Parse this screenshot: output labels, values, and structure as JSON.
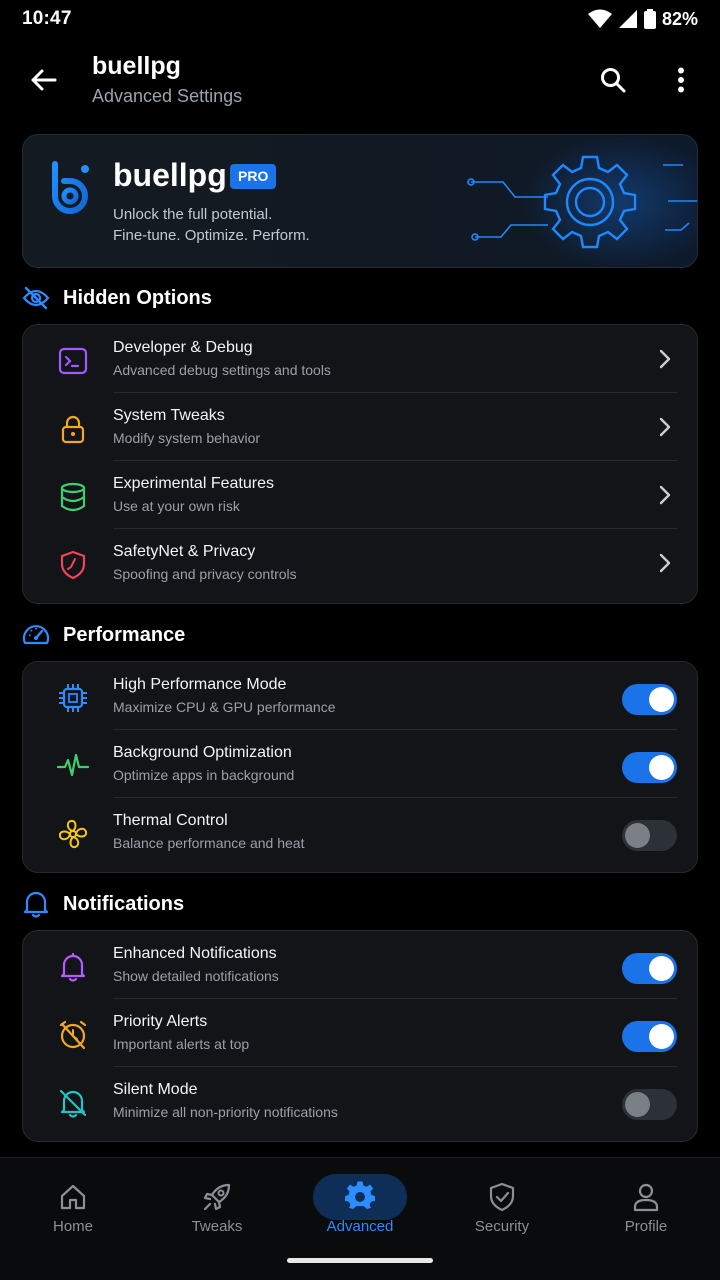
{
  "status": {
    "time": "10:47",
    "battery": "82%"
  },
  "appbar": {
    "title": "buellpg",
    "subtitle": "Advanced Settings"
  },
  "hero": {
    "name": "buellpg",
    "badge": "PRO",
    "line1": "Unlock the full potential.",
    "line2": "Fine-tune. Optimize. Perform."
  },
  "sections": {
    "hidden": {
      "title": "Hidden Options",
      "items": [
        {
          "title": "Developer & Debug",
          "subtitle": "Advanced debug settings and tools",
          "icon": "terminal-icon",
          "color": "#a259ff"
        },
        {
          "title": "System Tweaks",
          "subtitle": "Modify system behavior",
          "icon": "lock-icon",
          "color": "#f5a623"
        },
        {
          "title": "Experimental Features",
          "subtitle": "Use at your own risk",
          "icon": "database-icon",
          "color": "#3ecf6e"
        },
        {
          "title": "SafetyNet & Privacy",
          "subtitle": "Spoofing and privacy controls",
          "icon": "shield-icon",
          "color": "#f0445a"
        }
      ]
    },
    "performance": {
      "title": "Performance",
      "items": [
        {
          "title": "High Performance Mode",
          "subtitle": "Maximize CPU & GPU performance",
          "icon": "cpu-icon",
          "color": "#2d8cff",
          "on": true
        },
        {
          "title": "Background Optimization",
          "subtitle": "Optimize apps in background",
          "icon": "pulse-icon",
          "color": "#3ecf6e",
          "on": true
        },
        {
          "title": "Thermal Control",
          "subtitle": "Balance performance and heat",
          "icon": "fan-icon",
          "color": "#f5c518",
          "on": false
        }
      ]
    },
    "notifications": {
      "title": "Notifications",
      "items": [
        {
          "title": "Enhanced Notifications",
          "subtitle": "Show detailed notifications",
          "icon": "bell-icon",
          "color": "#b35cff",
          "on": true
        },
        {
          "title": "Priority Alerts",
          "subtitle": "Important alerts at top",
          "icon": "alarm-off-icon",
          "color": "#f5a623",
          "on": true
        },
        {
          "title": "Silent Mode",
          "subtitle": "Minimize all non-priority notifications",
          "icon": "bell-off-icon",
          "color": "#22c4c4",
          "on": false
        }
      ]
    }
  },
  "nav": [
    {
      "label": "Home",
      "icon": "home-icon"
    },
    {
      "label": "Tweaks",
      "icon": "rocket-icon"
    },
    {
      "label": "Advanced",
      "icon": "gear-icon",
      "active": true
    },
    {
      "label": "Security",
      "icon": "shield-check-icon"
    },
    {
      "label": "Profile",
      "icon": "person-icon"
    }
  ],
  "colors": {
    "accent": "#1a73e8",
    "background": "#000000",
    "card": "#121418"
  }
}
